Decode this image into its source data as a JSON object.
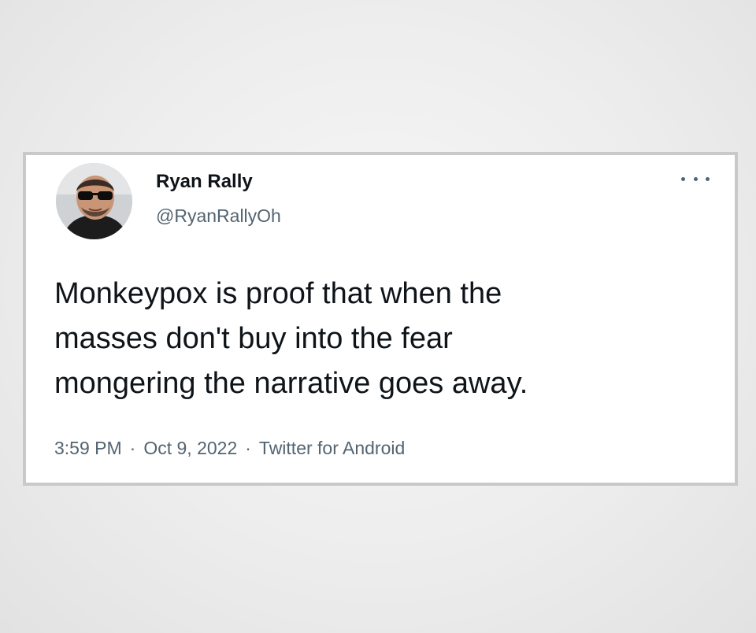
{
  "tweet": {
    "author": {
      "display_name": "Ryan Rally",
      "handle": "@RyanRallyOh",
      "avatar_icon": "profile-photo"
    },
    "menu_icon": "more-options-icon",
    "text": "Monkeypox is proof that when the\nmasses don't buy into the fear\nmongering the narrative goes away.",
    "time": "3:59 PM",
    "date": "Oct 9, 2022",
    "source": "Twitter for Android",
    "separator": "·"
  },
  "colors": {
    "primary_text": "#0f1419",
    "secondary_text": "#536471",
    "card_border": "#c9c9c9",
    "background": "#ececec"
  }
}
